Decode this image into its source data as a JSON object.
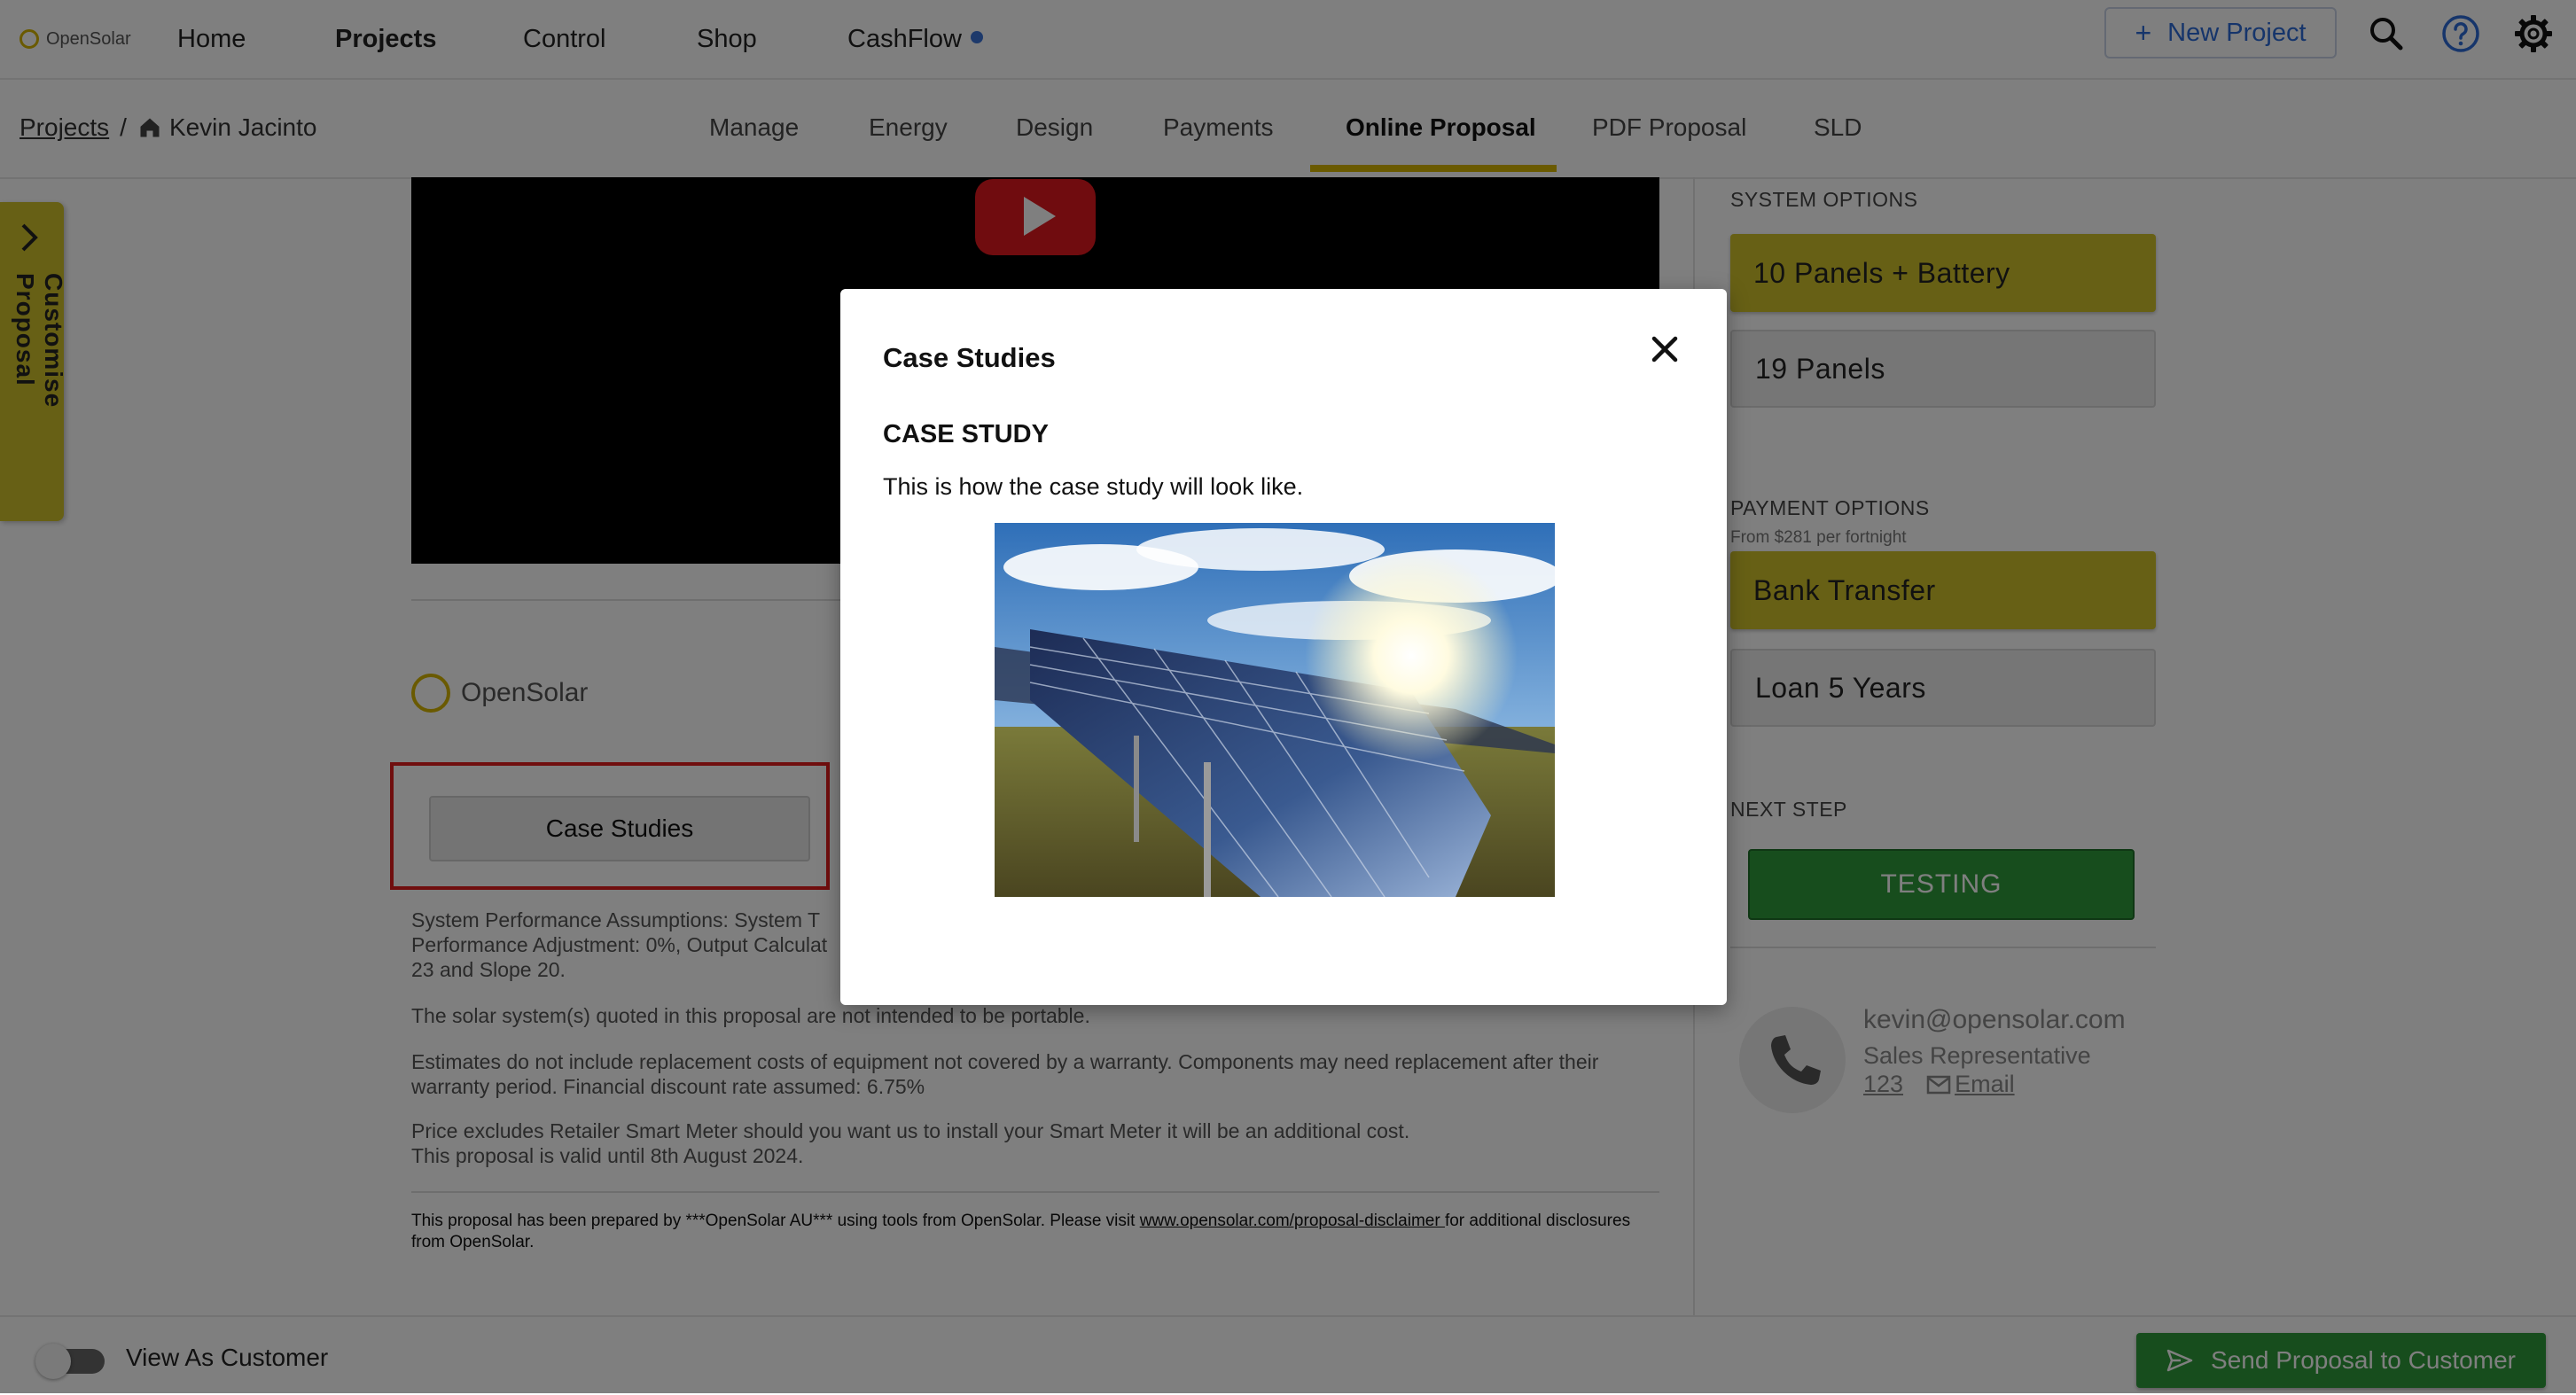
{
  "topnav": {
    "logo_text": "OpenSolar",
    "items": [
      "Home",
      "Projects",
      "Control",
      "Shop",
      "CashFlow"
    ],
    "new_project_label": "New Project",
    "icons": [
      "search-icon",
      "help-icon",
      "gear-icon"
    ]
  },
  "breadcrumb": {
    "root": "Projects",
    "separator": "/",
    "current": "Kevin Jacinto"
  },
  "tabs": [
    "Manage",
    "Energy",
    "Design",
    "Payments",
    "Online Proposal",
    "PDF Proposal",
    "SLD"
  ],
  "active_tab": "Online Proposal",
  "customise_tab": {
    "label": "Customise Proposal"
  },
  "main": {
    "logo_text": "OpenSolar",
    "case_studies_button": "Case Studies",
    "assumptions_line1": "System Performance Assumptions: System T",
    "assumptions_line2": "Performance Adjustment: 0%, Output Calculat",
    "assumptions_line3": "23 and Slope 20.",
    "portable_text": "The solar system(s) quoted in this proposal are not intended to be portable.",
    "estimates_line1": "Estimates do not include replacement costs of equipment not covered by a warranty. Components may need replacement after their",
    "estimates_line2": "warranty period. Financial discount rate assumed: 6.75%",
    "price_line1": "Price excludes Retailer Smart Meter should you want us to install your Smart Meter it will be an additional cost.",
    "price_line2": "This proposal is valid until 8th August 2024.",
    "disclaimer_before": "This proposal has been prepared by ***OpenSolar AU*** using tools from OpenSolar. Please visit ",
    "disclaimer_link": "www.opensolar.com/proposal-disclaimer ",
    "disclaimer_after": "for additional disclosures from OpenSolar."
  },
  "right_panel": {
    "system_options_label": "SYSTEM OPTIONS",
    "system_options": [
      "10 Panels + Battery",
      "19 Panels"
    ],
    "payment_options_label": "PAYMENT OPTIONS",
    "payment_from": "From $281 per fortnight",
    "payment_options": [
      "Bank Transfer",
      "Loan 5 Years"
    ],
    "next_step_label": "NEXT STEP",
    "next_step_button": "TESTING",
    "contact": {
      "email": "kevin@opensolar.com",
      "role": "Sales Representative",
      "phone": "123",
      "email_link": "Email"
    }
  },
  "bottombar": {
    "view_as_customer": "View As Customer",
    "send_button": "Send Proposal to Customer"
  },
  "modal": {
    "title": "Case Studies",
    "heading": "CASE STUDY",
    "body": "This is how the case study will look like."
  },
  "colors": {
    "accent_yellow": "#d4b400",
    "option_selected": "#cfc02a",
    "primary_blue": "#2c6ad6",
    "green": "#2f9a3a",
    "highlight_red": "#e11d1d"
  }
}
